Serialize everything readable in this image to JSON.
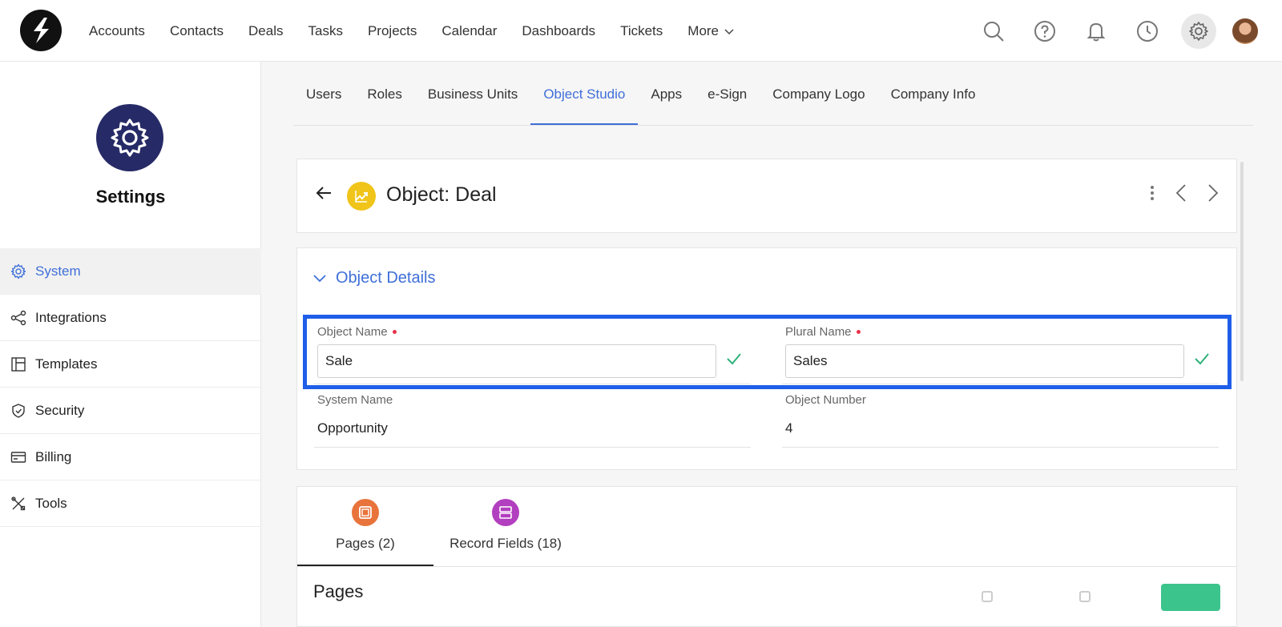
{
  "nav": {
    "links": [
      "Accounts",
      "Contacts",
      "Deals",
      "Tasks",
      "Projects",
      "Calendar",
      "Dashboards",
      "Tickets"
    ],
    "more_label": "More",
    "icons": [
      "search-icon",
      "help-icon",
      "bell-icon",
      "clock-icon",
      "gear-icon"
    ]
  },
  "sidebar": {
    "title": "Settings",
    "items": [
      {
        "label": "System",
        "icon": "gear-icon",
        "active": true
      },
      {
        "label": "Integrations",
        "icon": "share-icon"
      },
      {
        "label": "Templates",
        "icon": "template-icon"
      },
      {
        "label": "Security",
        "icon": "shield-icon"
      },
      {
        "label": "Billing",
        "icon": "card-icon"
      },
      {
        "label": "Tools",
        "icon": "tools-icon"
      }
    ]
  },
  "tabs": [
    "Users",
    "Roles",
    "Business Units",
    "Object Studio",
    "Apps",
    "e-Sign",
    "Company Logo",
    "Company Info"
  ],
  "active_tab": "Object Studio",
  "header": {
    "title": "Object: Deal"
  },
  "details": {
    "section_title": "Object Details",
    "object_name": {
      "label": "Object Name",
      "value": "Sale"
    },
    "plural_name": {
      "label": "Plural Name",
      "value": "Sales"
    },
    "system_name": {
      "label": "System Name",
      "value": "Opportunity"
    },
    "object_number": {
      "label": "Object Number",
      "value": "4"
    }
  },
  "bottom": {
    "tabs": [
      {
        "label": "Pages (2)",
        "color": "#e8743b"
      },
      {
        "label": "Record Fields (18)",
        "color": "#b23fbf"
      }
    ],
    "section_title": "Pages"
  },
  "colors": {
    "accent": "#3f6fd8",
    "highlight": "#1f5ee8",
    "settings_badge": "#262a66",
    "object_icon": "#f0c419",
    "success": "#3cc48d"
  }
}
